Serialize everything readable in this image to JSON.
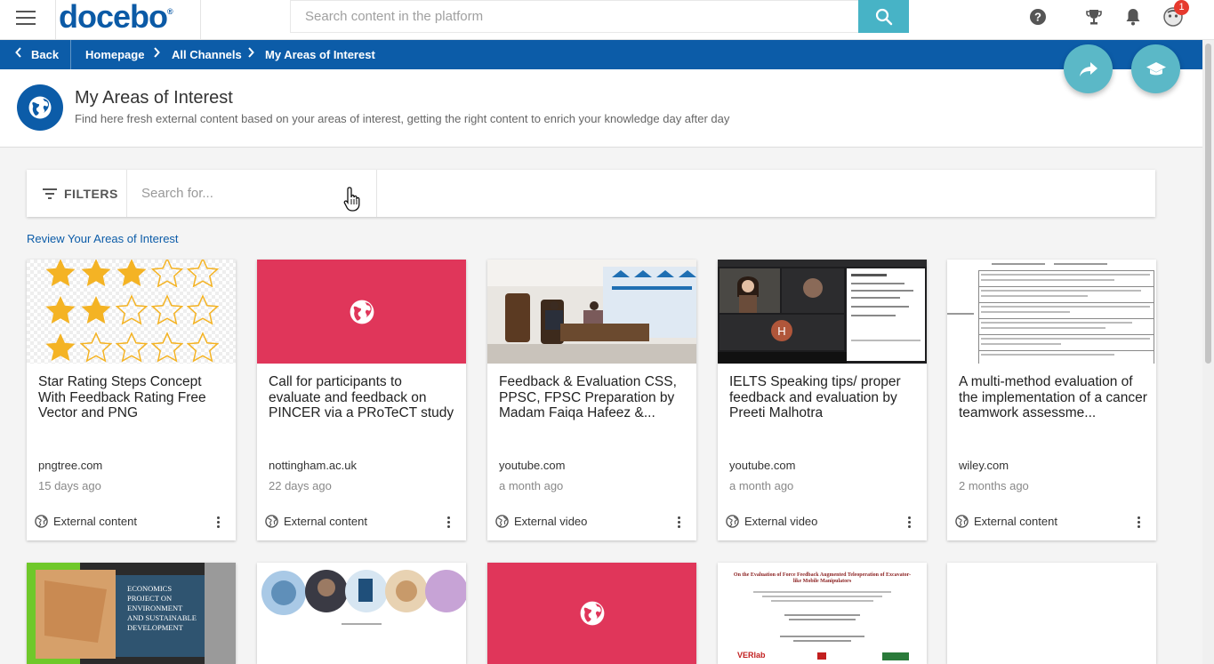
{
  "topbar": {
    "logo_text": "docebo",
    "logo_mark": "®",
    "search_placeholder": "Search content in the platform",
    "notification_count": "1"
  },
  "breadcrumb": {
    "back_label": "Back",
    "items": [
      "Homepage",
      "All Channels",
      "My Areas of Interest"
    ]
  },
  "header": {
    "title": "My Areas of Interest",
    "subtitle": "Find here fresh external content based on your areas of interest, getting the right content to enrich your knowledge day after day"
  },
  "filters": {
    "label": "FILTERS",
    "search_placeholder": "Search for..."
  },
  "review_link": "Review Your Areas of Interest",
  "cards": [
    {
      "title": "Star Rating Steps Concept With Feedback Rating Free Vector and PNG",
      "source": "pngtree.com",
      "date": "15 days ago",
      "type": "External content",
      "thumb": "stars"
    },
    {
      "title": "Call for participants to evaluate and feedback on PINCER via a PRoTeCT study",
      "source": "nottingham.ac.uk",
      "date": "22 days ago",
      "type": "External content",
      "thumb": "globe"
    },
    {
      "title": "Feedback & Evaluation CSS, PPSC, FPSC Preparation by Madam Faiqa Hafeez &...",
      "source": "youtube.com",
      "date": "a month ago",
      "type": "External video",
      "thumb": "room"
    },
    {
      "title": "IELTS Speaking tips/ proper feedback and evaluation by Preeti Malhotra",
      "source": "youtube.com",
      "date": "a month ago",
      "type": "External video",
      "thumb": "meeting"
    },
    {
      "title": "A multi-method evaluation of the implementation of a cancer teamwork assessme...",
      "source": "wiley.com",
      "date": "2 months ago",
      "type": "External content",
      "thumb": "doc"
    }
  ],
  "row2_thumb_texts": {
    "economics": [
      "ECONOMICS",
      "PROJECT ON",
      "ENVIRONMENT",
      "AND SUSTAINABLE",
      "DEVELOPMENT"
    ],
    "paper_title": "On the Evaluation of Force Feedback Augmented Teleoperation of Excavator-like Mobile Manipulators",
    "paper_logo": "VERlab"
  },
  "colors": {
    "brand_blue": "#0c5ca8",
    "accent_teal": "#47b3c6",
    "placeholder_red": "#e0365a"
  }
}
